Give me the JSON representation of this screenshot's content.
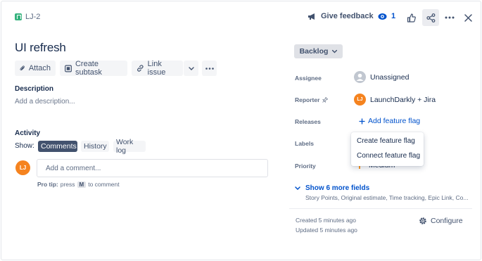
{
  "issue": {
    "key": "LJ-2",
    "title": "UI refresh"
  },
  "topbar": {
    "feedback_label": "Give feedback",
    "watch_count": "1",
    "icons": [
      "story-icon",
      "megaphone-icon",
      "eye-icon",
      "thumbs-up-icon",
      "share-icon",
      "more-icon",
      "close-icon"
    ]
  },
  "actions": {
    "attach": "Attach",
    "create_subtask": "Create subtask",
    "link_issue": "Link issue"
  },
  "description": {
    "heading": "Description",
    "placeholder": "Add a description..."
  },
  "activity": {
    "heading": "Activity",
    "show_label": "Show:",
    "filters": [
      "Comments",
      "History",
      "Work log"
    ],
    "active_filter": "Comments",
    "comment_placeholder": "Add a comment...",
    "protip_prefix": "Pro tip:",
    "protip_press": "press",
    "protip_key": "M",
    "protip_suffix": "to comment",
    "user_initials": "LJ"
  },
  "details": {
    "status": "Backlog",
    "assignee_label": "Assignee",
    "assignee_value": "Unassigned",
    "reporter_label": "Reporter",
    "reporter_value": "LaunchDarkly + Jira",
    "reporter_initials": "LJ",
    "releases_label": "Releases",
    "add_feature_flag": "Add feature flag",
    "labels_label": "Labels",
    "priority_label": "Priority",
    "priority_value": "Medium",
    "show_more": "Show 6 more fields",
    "more_fields_hint": "Story Points, Original estimate, Time tracking, Epic Link, Co...",
    "created": "Created 5 minutes ago",
    "updated": "Updated 5 minutes ago",
    "configure": "Configure"
  },
  "feature_flag_menu": {
    "items": [
      "Create feature flag",
      "Connect feature flag"
    ]
  },
  "colors": {
    "accent": "#0052CC",
    "story_green": "#36B37E",
    "avatar_orange": "#F5831F",
    "active_pill": "#42526E"
  }
}
